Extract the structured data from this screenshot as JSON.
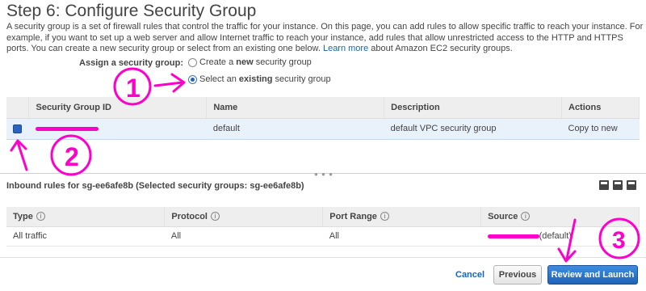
{
  "page": {
    "title": "Step 6: Configure Security Group",
    "description_text": "A security group is a set of firewall rules that control the traffic for your instance. On this page, you can add rules to allow specific traffic to reach your instance. For example, if you want to set up a web server and allow Internet traffic to reach your instance, add rules that allow unrestricted access to the HTTP and HTTPS ports. You can create a new security group or select from an existing one below.",
    "learn_more": "Learn more",
    "description_tail": "about Amazon EC2 security groups."
  },
  "assign": {
    "label": "Assign a security group:",
    "option_create_prefix": "Create a ",
    "option_create_bold": "new",
    "option_create_suffix": " security group",
    "option_existing_prefix": "Select an ",
    "option_existing_bold": "existing",
    "option_existing_suffix": " security group",
    "selected": "existing"
  },
  "sg_table": {
    "columns": [
      "Security Group ID",
      "Name",
      "Description",
      "Actions"
    ],
    "rows": [
      {
        "id": "",
        "name": "default",
        "description": "default VPC security group",
        "action": "Copy to new",
        "checked": true
      }
    ]
  },
  "inbound": {
    "title": "Inbound rules for sg-ee6afe8b (Selected security groups: sg-ee6afe8b)",
    "columns": [
      "Type",
      "Protocol",
      "Port Range",
      "Source"
    ],
    "rows": [
      {
        "type": "All traffic",
        "protocol": "All",
        "port_range": "All",
        "source": "(default)"
      }
    ]
  },
  "footer": {
    "cancel": "Cancel",
    "previous": "Previous",
    "review_launch": "Review and Launch"
  },
  "annotations": {
    "step1": "1",
    "step2": "2",
    "step3": "3"
  },
  "colors": {
    "accent": "#1166bb",
    "annotation": "#ff00cc",
    "primary_button": "#2a6fc9"
  }
}
